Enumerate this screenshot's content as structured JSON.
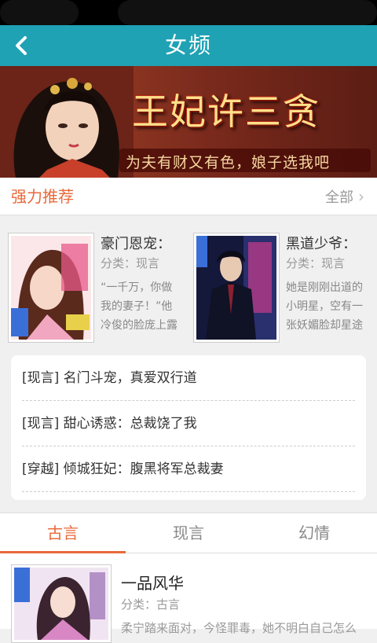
{
  "header": {
    "title": "女频"
  },
  "banner": {
    "headline": "王妃许三贪",
    "tagline": "为夫有财又有色，娘子选我吧"
  },
  "section": {
    "title": "强力推荐",
    "more_label": "全部"
  },
  "recommendations": [
    {
      "title": "豪门恩宠：",
      "category": "分类：现言",
      "excerpt": "“一千万，你做我的妻子！”他冷俊的脸庞上露"
    },
    {
      "title": "黑道少爷：",
      "category": "分类：现言",
      "excerpt": "她是刚刚出道的小明星，空有一张妖媚脸却星途"
    }
  ],
  "list": [
    {
      "tag": "[现言]",
      "title": "名门斗宠，真爱双行道"
    },
    {
      "tag": "[现言]",
      "title": "甜心诱惑：总裁饶了我"
    },
    {
      "tag": "[穿越]",
      "title": "倾城狂妃：腹黑将军总裁妻"
    }
  ],
  "tabs": [
    {
      "label": "古言",
      "active": true
    },
    {
      "label": "现言",
      "active": false
    },
    {
      "label": "幻情",
      "active": false
    }
  ],
  "book": {
    "title": "一品风华",
    "category": "分类：古言",
    "excerpt": "柔宁踏来面对，今怪罪毒，她不明白自己怎么"
  },
  "colors": {
    "header": "#1fa2b4",
    "accent": "#e8693a"
  }
}
